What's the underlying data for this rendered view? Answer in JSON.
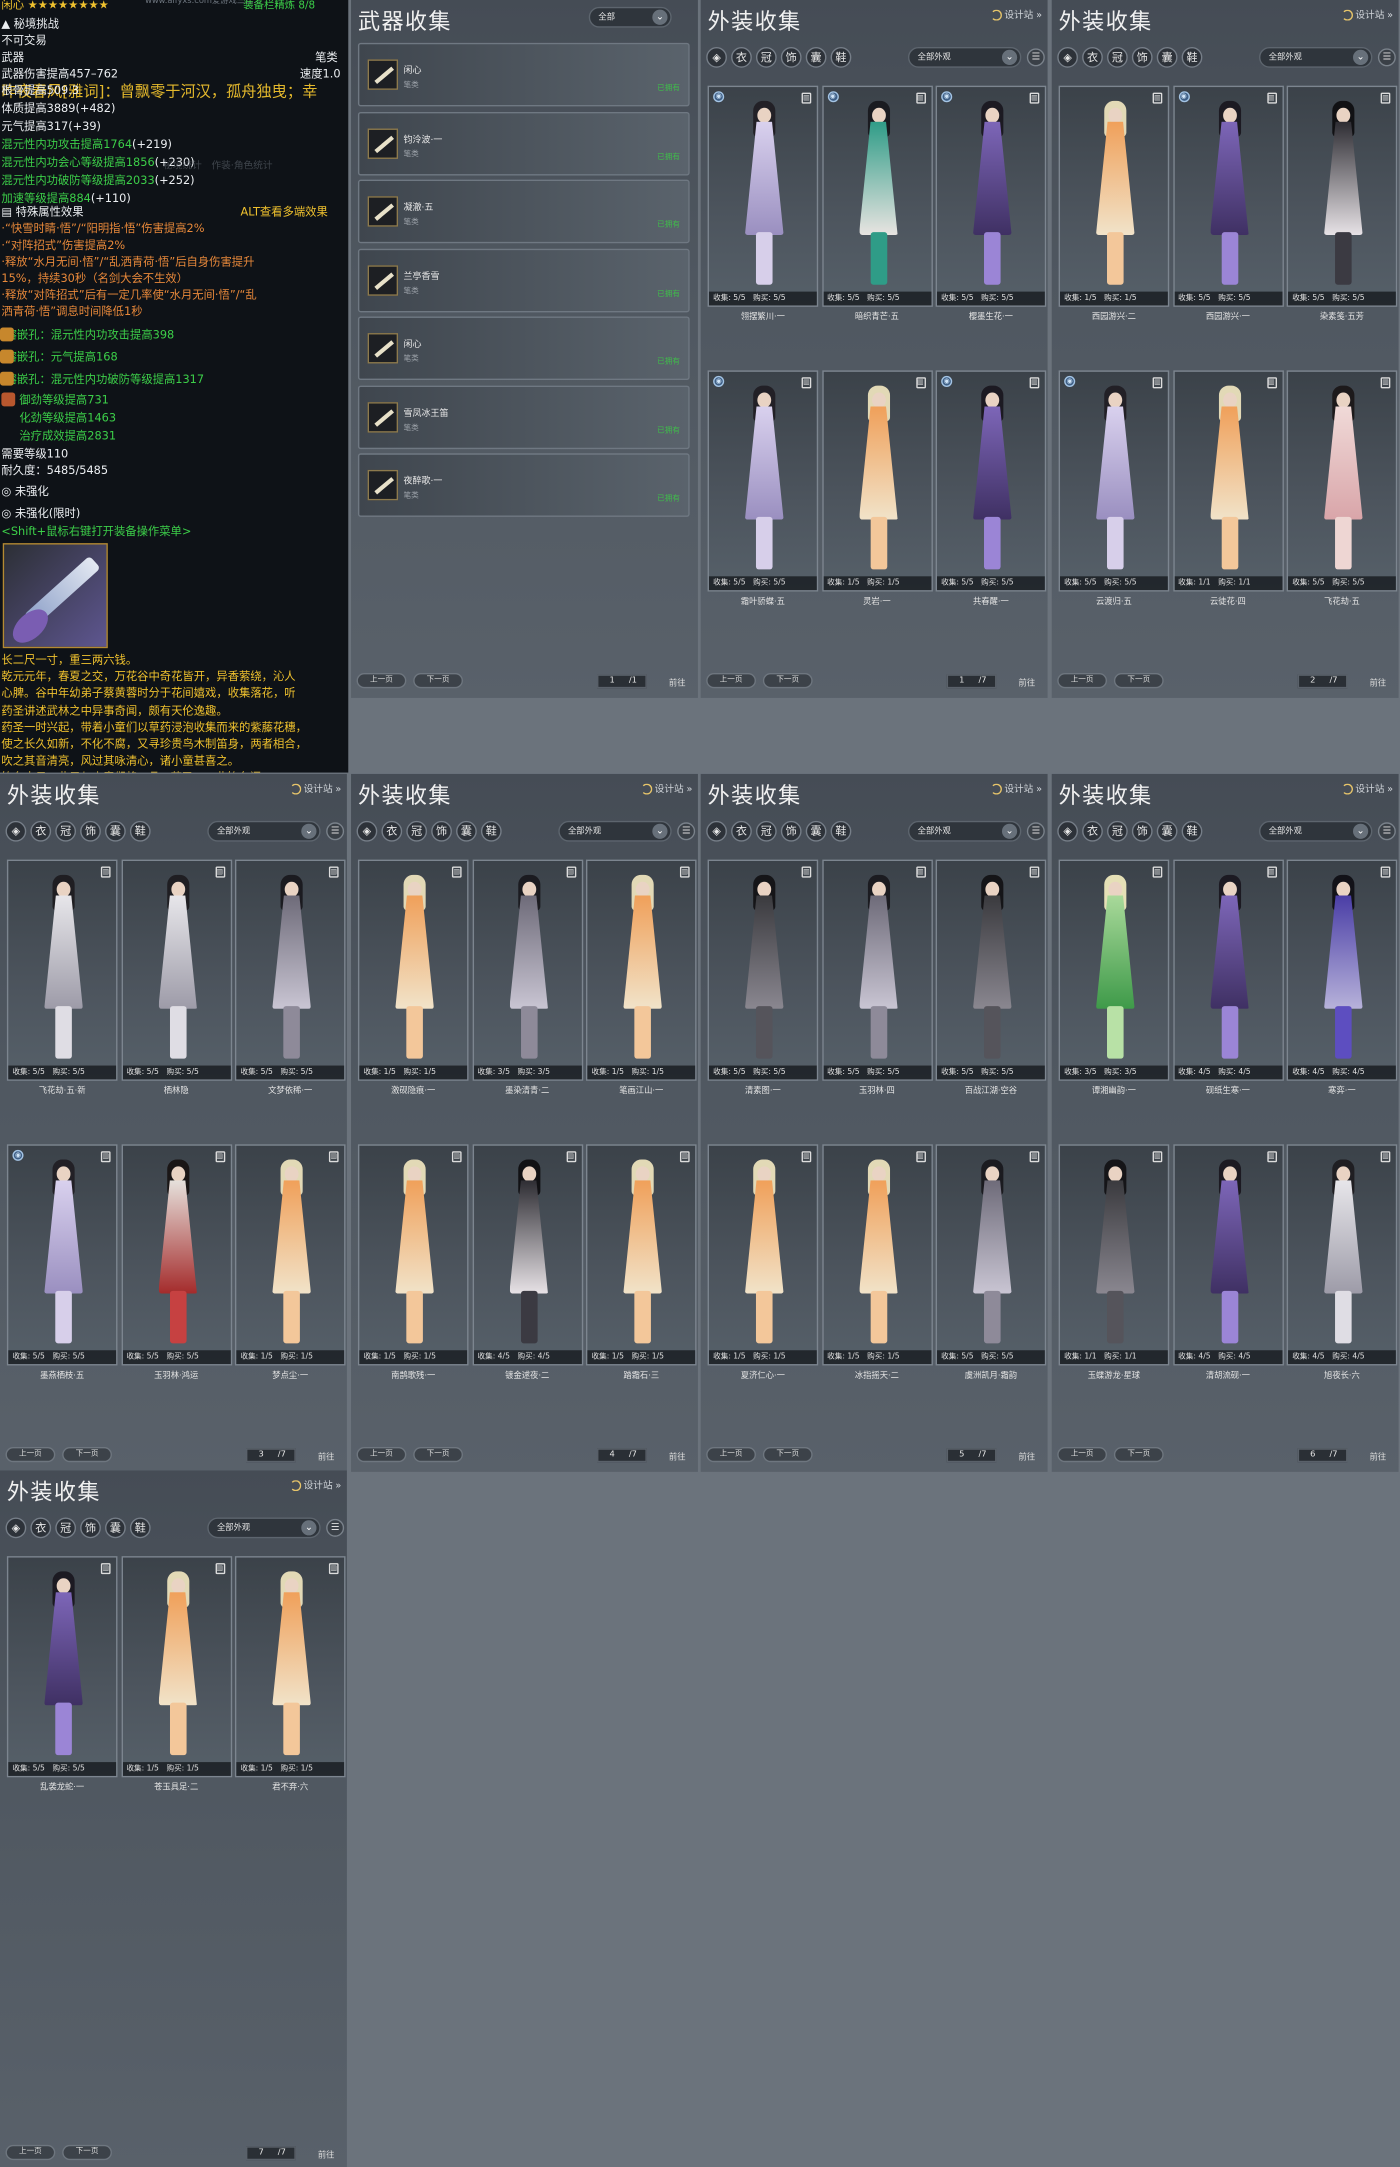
{
  "tooltip": {
    "header_name": "闲心 ★★★★★★★★",
    "header_url": "www.aifyxs.com爱游戏三仁...",
    "refine": "装备栏精炼 8/8",
    "secret_challenge": "秘境挑战",
    "no_trade": "不可交易",
    "weapon_label": "武器",
    "weapon_class": "笔类",
    "damage": "武器伤害提高457–762",
    "speed": "速度1.0",
    "overlay_quote": "昨夜春风[雅词]：曾飘零于河汉，孤舟独曳；幸",
    "stat_lines": [
      {
        "text": "根骨提高509.3",
        "cls": "w"
      },
      {
        "text": "体质提高3889",
        "bonus": "(+482)",
        "cls": "w"
      },
      {
        "text": "元气提高317",
        "bonus": "(+39)",
        "cls": "w"
      },
      {
        "text": "混元性内功攻击提高1764",
        "bonus": "(+219)",
        "cls": "g"
      },
      {
        "text": "混元性内功会心等级提高1856",
        "bonus": "(+230)",
        "cls": "g"
      },
      {
        "text": "混元性内功破防等级提高2033",
        "bonus": "(+252)",
        "cls": "g"
      },
      {
        "text": "加速等级提高884",
        "bonus": "(+110)",
        "cls": "g"
      }
    ],
    "special_effect": "特殊属性效果",
    "alt_hint": "ALT查看多端效果",
    "effects": [
      "·“快雪时睛·悟”/“阳明指·悟”伤害提高2%",
      "·“对阵招式”伤害提高2%",
      "·释放“水月无间·悟”/“乱洒青荷·悟”后自身伤害提升",
      "15%，持续30秒（名剑大会不生效）",
      "·释放“对阵招式”后有一定几率使“水月无间·悟”/“乱",
      "洒青荷·悟”调息时间降低1秒"
    ],
    "sockets": [
      "熔嵌孔：混元性内功攻击提高398",
      "熔嵌孔：元气提高168",
      "熔嵌孔：混元性内功破防等级提高1317"
    ],
    "enchants": [
      "御劲等级提高731",
      "化劲等级提高1463",
      "治疗成效提高2831"
    ],
    "require_level": "需要等级110",
    "durability": "耐久度：5485/5485",
    "not_strengthened": "未强化",
    "not_strengthened_limited": "未强化(限时)",
    "shift_hint": "<Shift+鼠标右键打开装备操作菜单>",
    "desc": [
      "长二尺一寸，重三两六钱。",
      "乾元元年，春夏之交，万花谷中奇花皆开，异香萦绕，沁人",
      "心脾。谷中年幼弟子蔡黄蓉时分于花间嬉戏，收集落花，听",
      "药圣讲述武林之中异事奇闻，颇有天伦逸趣。",
      "药圣一时兴起，带着小童们以草药浸泡收集而来的紫藤花穗，",
      "使之长久如新，不化不腐，又寻珍贵鸟木制笛身，两者相合，",
      "吹之其音清亮，风过其咏清心，诸小童甚喜之。",
      "笛名十日，此子与小童们将五品...药圣曰：此笛名闲"
    ],
    "ghost_tabs": "秘境统计　作装·角色统计"
  },
  "weapon_panel": {
    "title": "武器收集",
    "filter": "全部",
    "items": [
      {
        "name": "闲心",
        "type": "笔类",
        "status": "已拥有"
      },
      {
        "name": "钧泠波·一",
        "type": "笔类",
        "status": "已拥有"
      },
      {
        "name": "凝澈·五",
        "type": "笔类",
        "status": "已拥有"
      },
      {
        "name": "兰亭香雪",
        "type": "笔类",
        "status": "已拥有"
      },
      {
        "name": "闲心",
        "type": "笔类",
        "status": "已拥有"
      },
      {
        "name": "雪凤冰王笛",
        "type": "笔类",
        "status": "已拥有"
      },
      {
        "name": "夜醉歌·一",
        "type": "笔类",
        "status": "已拥有"
      }
    ],
    "prev": "上一页",
    "next": "下一页",
    "page": "1",
    "total": "/1",
    "jump": "前往"
  },
  "common": {
    "design_label": "设计站",
    "filter": "全部外观",
    "prev": "上一页",
    "next": "下一页",
    "jump": "前往",
    "cat_icons": [
      "◈",
      "衣",
      "冠",
      "饰",
      "囊",
      "鞋"
    ]
  },
  "outfit_panels": [
    {
      "title": "外装收集",
      "page": "1",
      "total": "/7",
      "items": [
        {
          "name": "翎摆繁川·一",
          "stat": "收集: 5/5　购买: 5/5",
          "palette": "lavender",
          "mark": true
        },
        {
          "name": "暗织青芒·五",
          "stat": "收集: 5/5　购买: 5/5",
          "palette": "teal",
          "mark": true
        },
        {
          "name": "樱墨生花·一",
          "stat": "收集: 5/5　购买: 5/5",
          "palette": "violet",
          "mark": true
        },
        {
          "name": "霜叶骄蝶·五",
          "stat": "收集: 5/5　购买: 5/5",
          "palette": "lavender",
          "mark": true
        },
        {
          "name": "灵岩·一",
          "stat": "收集: 1/5　购买: 1/5",
          "palette": "orange",
          "mark": false
        },
        {
          "name": "共春醒·一",
          "stat": "收集: 5/5　购买: 5/5",
          "palette": "violet",
          "mark": true
        }
      ]
    },
    {
      "title": "外装收集",
      "page": "2",
      "total": "/7",
      "items": [
        {
          "name": "西园游兴·二",
          "stat": "收集: 1/5　购买: 1/5",
          "palette": "orange",
          "mark": false
        },
        {
          "name": "西园游兴·一",
          "stat": "收集: 5/5　购买: 5/5",
          "palette": "violet",
          "mark": true
        },
        {
          "name": "染素笺·五芳",
          "stat": "收集: 5/5　购买: 5/5",
          "palette": "black",
          "mark": false
        },
        {
          "name": "云渡归·五",
          "stat": "收集: 5/5　购买: 5/5",
          "palette": "lavender",
          "mark": true
        },
        {
          "name": "云徒花·四",
          "stat": "收集: 1/1　购买: 1/1",
          "palette": "orange",
          "mark": false
        },
        {
          "name": "飞花劫·五",
          "stat": "收集: 5/5　购买: 5/5",
          "palette": "pink",
          "mark": false
        }
      ]
    },
    {
      "title": "外装收集",
      "page": "3",
      "total": "/7",
      "items": [
        {
          "name": "飞花劫·五·新",
          "stat": "收集: 5/5　购买: 5/5",
          "palette": "white",
          "mark": false
        },
        {
          "name": "栖林隐",
          "stat": "收集: 5/5　购买: 5/5",
          "palette": "white",
          "mark": false
        },
        {
          "name": "文梦依稀·一",
          "stat": "收集: 5/5　购买: 5/5",
          "palette": "gray",
          "mark": false
        },
        {
          "name": "墨燕栖枝·五",
          "stat": "收集: 5/5　购买: 5/5",
          "palette": "lavender",
          "mark": true
        },
        {
          "name": "玉羽林·鸿运",
          "stat": "收集: 5/5　购买: 5/5",
          "palette": "red",
          "mark": false
        },
        {
          "name": "梦点尘·一",
          "stat": "收集: 1/5　购买: 1/5",
          "palette": "orange",
          "mark": false
        }
      ]
    },
    {
      "title": "外装收集",
      "page": "4",
      "total": "/7",
      "items": [
        {
          "name": "激砚隐痕·一",
          "stat": "收集: 1/5　购买: 1/5",
          "palette": "orange",
          "mark": false
        },
        {
          "name": "墨染清青·二",
          "stat": "收集: 3/5　购买: 3/5",
          "palette": "gray",
          "mark": false
        },
        {
          "name": "笔画江山·一",
          "stat": "收集: 1/5　购买: 1/5",
          "palette": "orange",
          "mark": false
        },
        {
          "name": "南鹊歌残·一",
          "stat": "收集: 1/5　购买: 1/5",
          "palette": "orange",
          "mark": false
        },
        {
          "name": "镀金逑夜·二",
          "stat": "收集: 4/5　购买: 4/5",
          "palette": "black",
          "mark": false
        },
        {
          "name": "踏霜石·三",
          "stat": "收集: 1/5　购买: 1/5",
          "palette": "orange",
          "mark": false
        }
      ]
    },
    {
      "title": "外装收集",
      "page": "5",
      "total": "/7",
      "items": [
        {
          "name": "清素图·一",
          "stat": "收集: 5/5　购买: 5/5",
          "palette": "dark",
          "mark": false
        },
        {
          "name": "玉羽林·四",
          "stat": "收集: 5/5　购买: 5/5",
          "palette": "gray",
          "mark": false
        },
        {
          "name": "百战江湖·空谷",
          "stat": "收集: 5/5　购买: 5/5",
          "palette": "dark",
          "mark": false
        },
        {
          "name": "夏济仁心·一",
          "stat": "收集: 1/5　购买: 1/5",
          "palette": "orange",
          "mark": false
        },
        {
          "name": "冰指摇天·二",
          "stat": "收集: 1/5　购买: 1/5",
          "palette": "orange",
          "mark": false
        },
        {
          "name": "虞洲凯月·霜韵",
          "stat": "收集: 5/5　购买: 5/5",
          "palette": "gray",
          "mark": false
        }
      ]
    },
    {
      "title": "外装收集",
      "page": "6",
      "total": "/7",
      "items": [
        {
          "name": "谭湘幽韵·一",
          "stat": "收集: 3/5　购买: 3/5",
          "palette": "green",
          "mark": false
        },
        {
          "name": "砚纸生寒·一",
          "stat": "收集: 4/5　购买: 4/5",
          "palette": "violet",
          "mark": false
        },
        {
          "name": "寒弈·一",
          "stat": "收集: 4/5　购买: 4/5",
          "palette": "blue",
          "mark": false
        },
        {
          "name": "玉蝶游龙·星球",
          "stat": "收集: 1/1　购买: 1/1",
          "palette": "dark",
          "mark": false
        },
        {
          "name": "清胡流砚·一",
          "stat": "收集: 4/5　购买: 4/5",
          "palette": "violet",
          "mark": false
        },
        {
          "name": "旭夜长·六",
          "stat": "收集: 4/5　购买: 4/5",
          "palette": "white",
          "mark": false
        }
      ]
    },
    {
      "title": "外装收集",
      "page": "7",
      "total": "/7",
      "items": [
        {
          "name": "乱袭龙蛇·一",
          "stat": "收集: 5/5　购买: 5/5",
          "palette": "violet",
          "mark": false
        },
        {
          "name": "苍玉具足·二",
          "stat": "收集: 1/5　购买: 1/5",
          "palette": "orange",
          "mark": false
        },
        {
          "name": "君不弃·六",
          "stat": "收集: 1/5　购买: 1/5",
          "palette": "orange",
          "mark": false
        }
      ]
    }
  ],
  "palettes": {
    "lavender": [
      "#d9d1ee",
      "#9a8fc0",
      "#222026",
      "#d7cfea"
    ],
    "teal": [
      "#2f9c87",
      "#e8e4e1",
      "#1a1b20",
      "#2f9c87"
    ],
    "violet": [
      "#7d66b8",
      "#3f3063",
      "#1c1a22",
      "#9b85d6"
    ],
    "orange": [
      "#f0a05a",
      "#f1e3c9",
      "#e2d9b6",
      "#f3c79a"
    ],
    "black": [
      "#2e2d33",
      "#e7e2e6",
      "#111114",
      "#3b3a42"
    ],
    "pink": [
      "#f0dad8",
      "#d9a5a9",
      "#1d1a1b",
      "#eed6d3"
    ],
    "white": [
      "#e7e6ea",
      "#9d9ba8",
      "#1f1e22",
      "#dfdde4"
    ],
    "gray": [
      "#6e6b79",
      "#c9c5d3",
      "#1b1b20",
      "#8e8a99"
    ],
    "red": [
      "#e6e1dc",
      "#a42b2b",
      "#1a1616",
      "#c64141"
    ],
    "dark": [
      "#3a3a3e",
      "#8a8790",
      "#151518",
      "#55545b"
    ],
    "green": [
      "#a9d99a",
      "#3e9a49",
      "#e5e0b6",
      "#b8e1a6"
    ],
    "blue": [
      "#4a3ea6",
      "#b7b2da",
      "#121218",
      "#5d4ec0"
    ]
  }
}
